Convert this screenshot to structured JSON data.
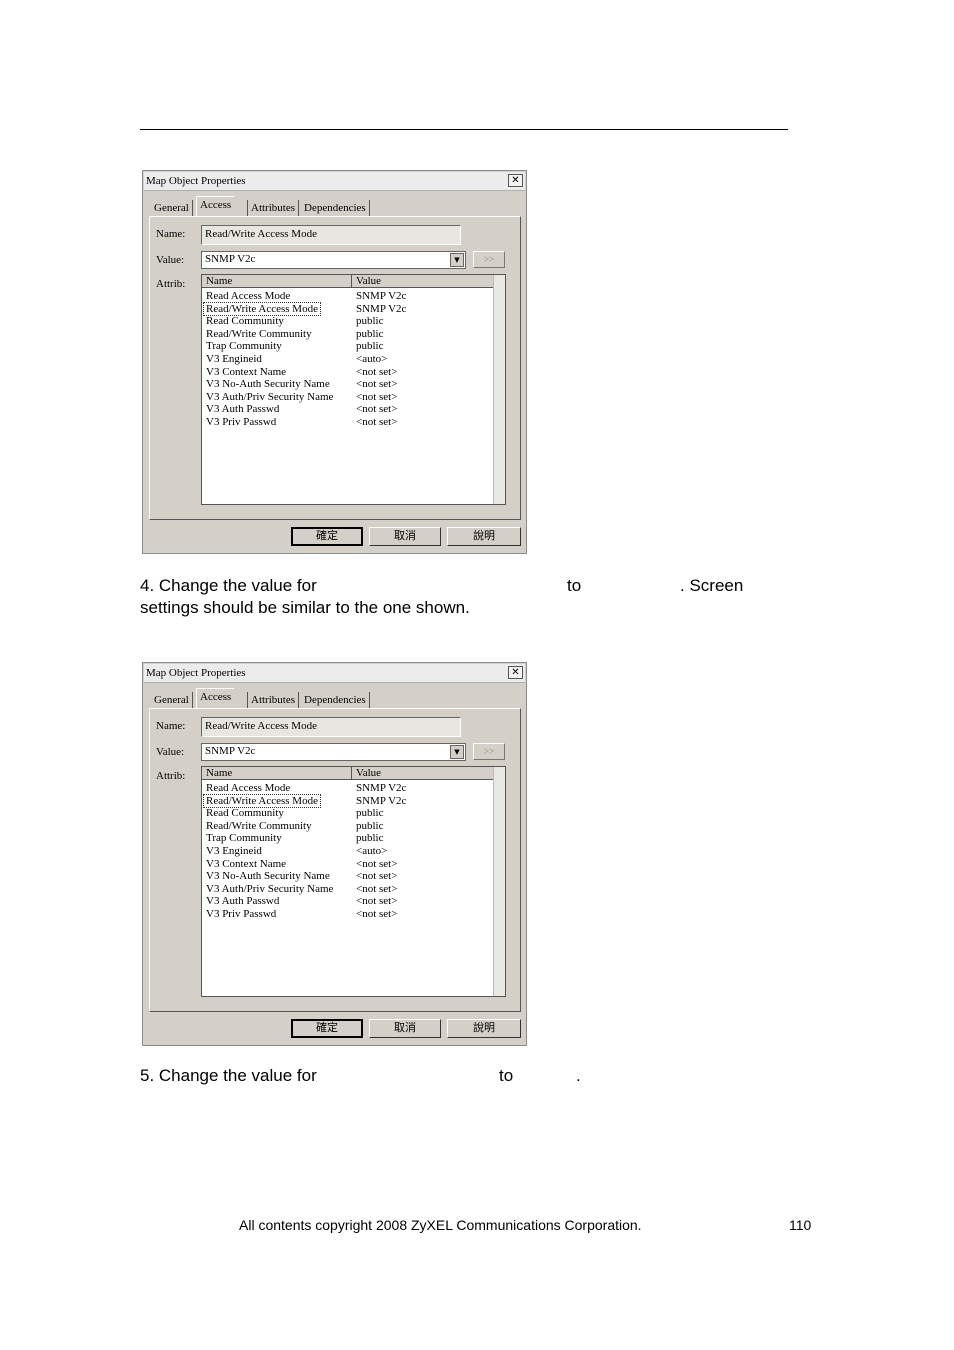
{
  "dialogs": [
    {
      "title": "Map Object Properties",
      "close_glyph": "✕",
      "tabs": [
        "General",
        "Access",
        "Attributes",
        "Dependencies"
      ],
      "name_label": "Name:",
      "name_value": "Read/Write Access Mode",
      "value_label": "Value:",
      "value_selected": "SNMP V2c",
      "more_button": ">>",
      "attrib_label": "Attrib:",
      "col_name": "Name",
      "col_value": "Value",
      "rows": [
        {
          "name": "Read Access Mode",
          "value": "SNMP V2c"
        },
        {
          "name": "Read/Write Access Mode",
          "value": "SNMP V2c"
        },
        {
          "name": "Read Community",
          "value": "public"
        },
        {
          "name": "Read/Write Community",
          "value": "public"
        },
        {
          "name": "Trap Community",
          "value": "public"
        },
        {
          "name": "V3 Engineid",
          "value": "<auto>"
        },
        {
          "name": "V3 Context Name",
          "value": "<not set>"
        },
        {
          "name": "V3 No-Auth Security Name",
          "value": "<not set>"
        },
        {
          "name": "V3 Auth/Priv Security Name",
          "value": "<not set>"
        },
        {
          "name": "V3 Auth Passwd",
          "value": "<not set>"
        },
        {
          "name": "V3 Priv Passwd",
          "value": "<not set>"
        }
      ],
      "ok_label": "確定",
      "cancel_label": "取消",
      "help_label": "說明"
    },
    {
      "title": "Map Object Properties",
      "close_glyph": "✕",
      "tabs": [
        "General",
        "Access",
        "Attributes",
        "Dependencies"
      ],
      "name_label": "Name:",
      "name_value": "Read/Write Access Mode",
      "value_label": "Value:",
      "value_selected": "SNMP V2c",
      "more_button": ">>",
      "attrib_label": "Attrib:",
      "col_name": "Name",
      "col_value": "Value",
      "rows": [
        {
          "name": "Read Access Mode",
          "value": "SNMP V2c"
        },
        {
          "name": "Read/Write Access Mode",
          "value": "SNMP V2c"
        },
        {
          "name": "Read Community",
          "value": "public"
        },
        {
          "name": "Read/Write Community",
          "value": "public"
        },
        {
          "name": "Trap Community",
          "value": "public"
        },
        {
          "name": "V3 Engineid",
          "value": "<auto>"
        },
        {
          "name": "V3 Context Name",
          "value": "<not set>"
        },
        {
          "name": "V3 No-Auth Security Name",
          "value": "<not set>"
        },
        {
          "name": "V3 Auth/Priv Security Name",
          "value": "<not set>"
        },
        {
          "name": "V3 Auth Passwd",
          "value": "<not set>"
        },
        {
          "name": "V3 Priv Passwd",
          "value": "<not set>"
        }
      ],
      "ok_label": "確定",
      "cancel_label": "取消",
      "help_label": "說明"
    }
  ],
  "step4": {
    "line1_a": "4. Change the value for",
    "line1_b": "to",
    "line1_c": ". Screen",
    "line2": "settings should be similar to the one shown."
  },
  "step5": {
    "part_a": "5. Change the value for",
    "part_b": "to",
    "part_c": "."
  },
  "footer": {
    "copyright": "All contents copyright 2008 ZyXEL Communications Corporation.",
    "page_number": "110"
  }
}
